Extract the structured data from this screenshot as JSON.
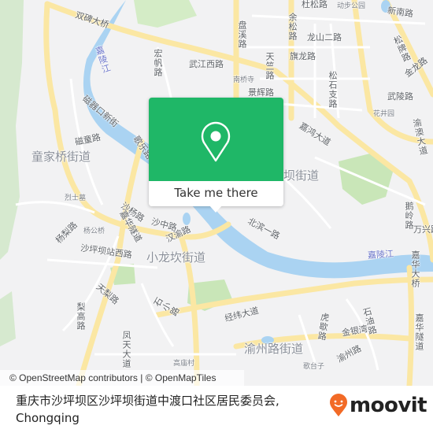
{
  "map": {
    "attribution": "© OpenStreetMap contributors | © OpenMapTiles",
    "labels": {
      "districts": [
        "童家桥街道",
        "坝街道",
        "小龙坎街道",
        "渝州路街道"
      ],
      "rivers": [
        "嘉陵江",
        "嘉陵江"
      ],
      "roads": [
        "双碑大桥",
        "宏帆路",
        "武江西路",
        "盘溪路",
        "余松路",
        "杜松路",
        "龙山二路",
        "天竺路",
        "旗龙路",
        "景辉路",
        "松石支路",
        "新南路",
        "松牌路",
        "金龙路",
        "武陵路",
        "渝澳大道",
        "磁器口新街",
        "磁童路",
        "歌乐路",
        "嘉鸿大道",
        "北滨一路",
        "沙杨路",
        "沙中路",
        "汉渝路",
        "杨梨路",
        "沙坪坝站西路",
        "天梨路",
        "梨高路",
        "凤天大道",
        "石小路",
        "经纬大道",
        "虎歇路",
        "石油路",
        "金银湾",
        "渝州路",
        "嘉华大桥",
        "嘉华隧道",
        "鹅岭路",
        "万兴路",
        "红"
      ],
      "places": [
        "动步公园",
        "南桥寺",
        "花井园",
        "烈士墓",
        "杨公桥",
        "高庙村",
        "歌台子"
      ]
    }
  },
  "popup": {
    "icon": "map-pin-icon",
    "button_label": "Take me there",
    "color": "#1fb767"
  },
  "footer": {
    "address_line1": "重庆市沙坪坝区沙坪坝街道中渡口社区居民委员会,",
    "address_line2": "Chongqing",
    "brand": "moovit",
    "brand_color": "#f26a26"
  }
}
